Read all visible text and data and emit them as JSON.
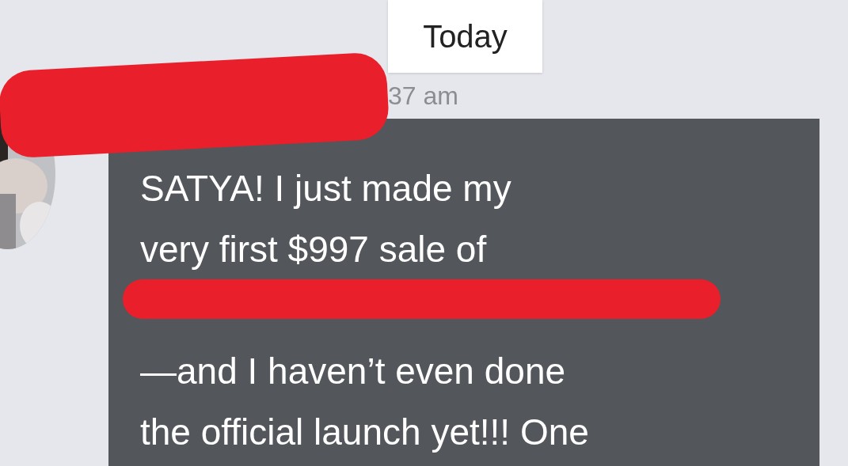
{
  "date_divider": {
    "label": "Today"
  },
  "message": {
    "time": "37 am",
    "sender_redacted": true,
    "lines": [
      {
        "kind": "text",
        "text": "SATYA! I just made my"
      },
      {
        "kind": "text",
        "text": "very first $997 sale of"
      },
      {
        "kind": "redacted"
      },
      {
        "kind": "text",
        "text": "—and I haven’t even done"
      },
      {
        "kind": "text",
        "text": "the official launch yet!!! One"
      }
    ]
  }
}
